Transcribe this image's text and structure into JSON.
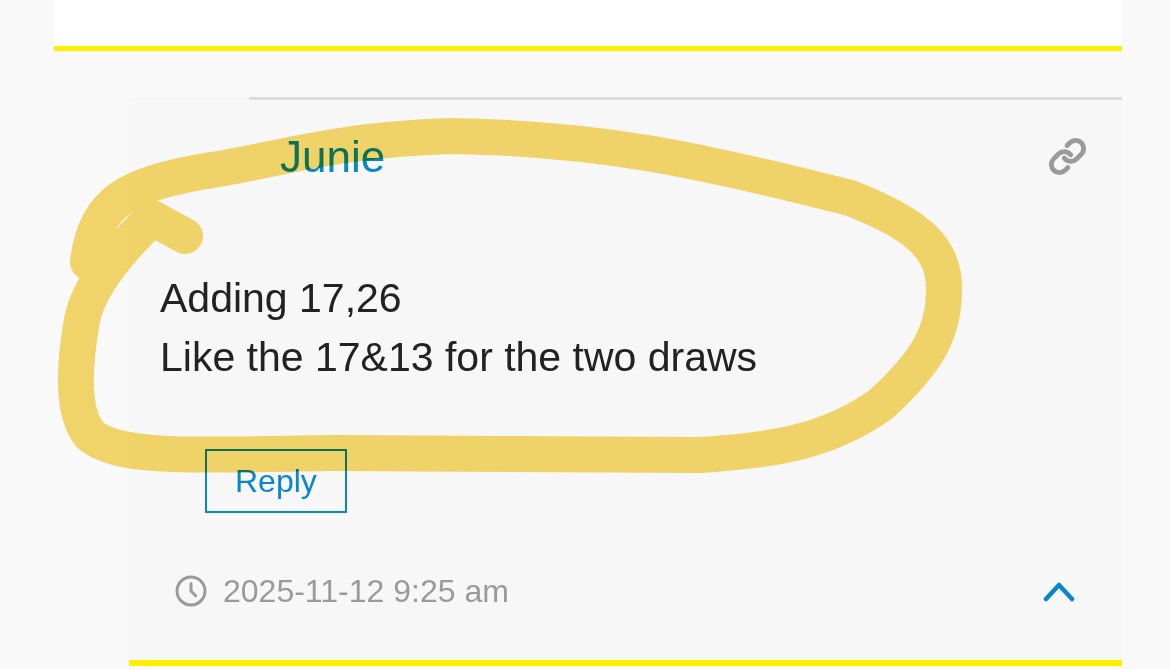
{
  "comment": {
    "author": "Junie",
    "body_lines": [
      "Adding 17,26",
      "Like the 17&13 for the two draws"
    ],
    "reply_button": "Reply",
    "timestamp": "2025-11-12 9:25 am"
  }
}
